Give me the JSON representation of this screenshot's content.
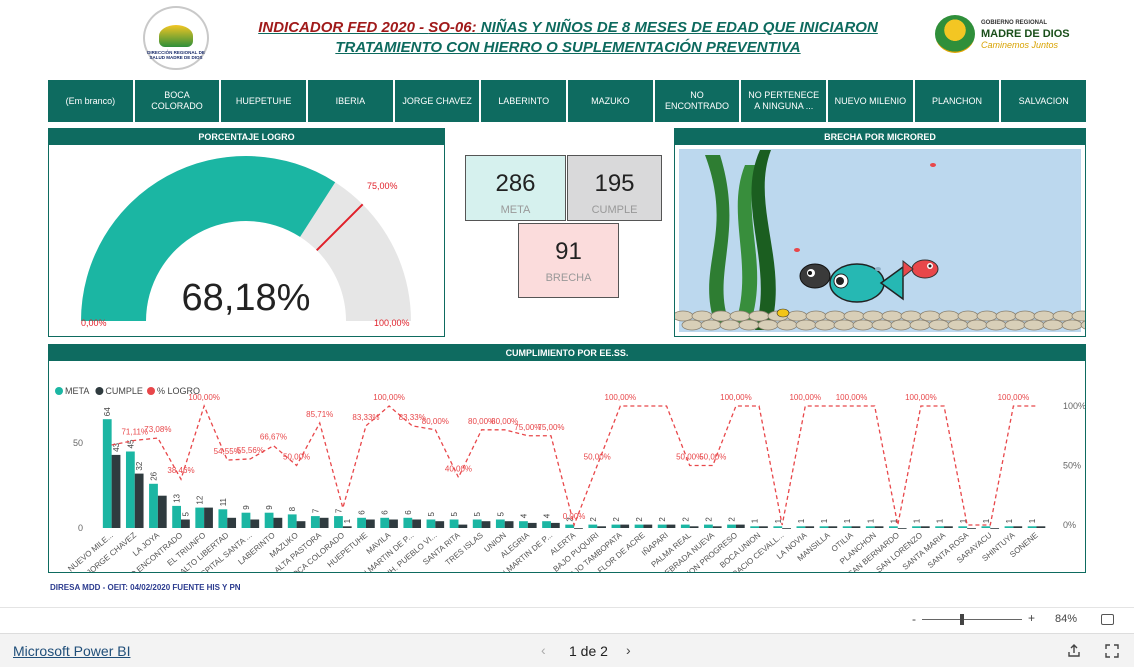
{
  "header": {
    "left_logo_text": "DIRECCIÓN REGIONAL DE SALUD MADRE DE DIOS",
    "title_part1": "INDICADOR FED 2020 - ",
    "title_code": "SO-06:",
    "title_part2": " NIÑAS Y NIÑOS DE 8 MESES DE EDAD QUE INICIARON",
    "title_line2": "TRATAMIENTO CON HIERRO O SUPLEMENTACIÓN PREVENTIVA",
    "right_logo": {
      "line1": "GOBIERNO REGIONAL",
      "line2": "MADRE DE DIOS",
      "line3": "Caminemos Juntos"
    }
  },
  "slicer": [
    "(Em branco)",
    "BOCA COLORADO",
    "HUEPETUHE",
    "IBERIA",
    "JORGE CHAVEZ",
    "LABERINTO",
    "MAZUKO",
    "NO ENCONTRADO",
    "NO PERTENECE A NINGUNA ...",
    "NUEVO MILENIO",
    "PLANCHON",
    "SALVACION"
  ],
  "gauge": {
    "title": "PORCENTAJE LOGRO",
    "value_label": "68,18%",
    "value": 68.18,
    "target": 75,
    "target_label": "75,00%",
    "min_label": "0,00%",
    "max_label": "100,00%",
    "fill_color": "#1bb6a3",
    "target_color": "#e0202a"
  },
  "kpis": {
    "meta": {
      "value": "286",
      "label": "META"
    },
    "cumple": {
      "value": "195",
      "label": "CUMPLE"
    },
    "brecha": {
      "value": "91",
      "label": "BRECHA"
    }
  },
  "aquarium": {
    "title": "BRECHA POR MICRORED"
  },
  "chart_title": "CUMPLIMIENTO POR EE.SS.",
  "chart_data": {
    "type": "bar",
    "legend": [
      "META",
      "CUMPLE",
      "% LOGRO"
    ],
    "colors": {
      "meta": "#1bb6a3",
      "cumple": "#2f3b3f",
      "logro": "#e8474a"
    },
    "categories": [
      "NUEVO MILE...",
      "JORGE CHAVEZ",
      "LA JOYA",
      "NO ENCONTRADO",
      "EL TRIUNFO",
      "ALTO LIBERTAD",
      "HOSPITAL SANTA ...",
      "LABERINTO",
      "MAZUKO",
      "ALTA PASTORA",
      "BOCA COLORADO",
      "HUEPETUHE",
      "MAVILA",
      "SAN MARTIN DE P...",
      "AA.HH. PUEBLO VI...",
      "SANTA RITA",
      "TRES ISLAS",
      "UNION",
      "ALEGRIA",
      "SAN MARTIN DE P...",
      "ALERTA",
      "BAJO PUQUIRI",
      "BAJO TAMBOPATA",
      "FLOR DE ACRE",
      "IÑAPARI",
      "PALMA REAL",
      "QUEBRADA NUEVA",
      "UNION PROGRESO",
      "BOCA UNION",
      "HORACIO CEVALL...",
      "LA NOVIA",
      "MANSILLA",
      "OTILIA",
      "PLANCHON",
      "SAN BERNARDO",
      "SAN LORENZO",
      "SANTA MARIA",
      "SANTA ROSA",
      "SARAYACU",
      "SHINTUYA",
      "SONENE"
    ],
    "meta": [
      64,
      45,
      26,
      13,
      12,
      11,
      9,
      9,
      8,
      7,
      7,
      6,
      6,
      6,
      5,
      5,
      5,
      5,
      4,
      4,
      2,
      2,
      2,
      2,
      2,
      2,
      2,
      2,
      1,
      1,
      1,
      1,
      1,
      1,
      1,
      1,
      1,
      1,
      1,
      1,
      1
    ],
    "cumple": [
      43,
      32,
      19,
      5,
      12,
      6,
      5,
      6,
      4,
      6,
      1,
      5,
      5,
      5,
      4,
      2,
      4,
      4,
      3,
      3,
      0,
      1,
      2,
      2,
      2,
      1,
      1,
      2,
      1,
      0,
      1,
      1,
      1,
      1,
      0,
      1,
      1,
      0,
      0,
      1,
      1
    ],
    "logro": [
      67.19,
      71.11,
      73.08,
      38.46,
      100.0,
      54.55,
      55.56,
      66.67,
      50.0,
      85.71,
      14.29,
      83.33,
      100.0,
      83.33,
      80.0,
      40.0,
      80.0,
      80.0,
      75.0,
      75.0,
      0.0,
      50.0,
      100.0,
      100.0,
      100.0,
      50.0,
      50.0,
      100.0,
      100.0,
      0.0,
      100.0,
      100.0,
      100.0,
      100.0,
      0.0,
      100.0,
      100.0,
      0.0,
      0.0,
      100.0,
      100.0
    ],
    "meta_labels": [
      "64",
      "45",
      "26",
      "13",
      "12",
      "11",
      "9",
      "9",
      "8",
      "7",
      "7",
      "6",
      "6",
      "6",
      "5",
      "5",
      "5",
      "5",
      "4",
      "4",
      "2",
      "2",
      "2",
      "2",
      "2",
      "2",
      "2",
      "2",
      "1",
      "1",
      "1",
      "1",
      "1",
      "1",
      "1",
      "1",
      "1",
      "1",
      "1",
      "1",
      "1"
    ],
    "cumple_labels": [
      "43",
      "32",
      "",
      "5",
      "",
      "",
      "",
      "",
      "",
      "",
      "1",
      "",
      "",
      "",
      "",
      "",
      "",
      "",
      "",
      "",
      "",
      "",
      "",
      "",
      "",
      "",
      "",
      "",
      "",
      "",
      "",
      "",
      "",
      "",
      "",
      "",
      "",
      "",
      "",
      "",
      ""
    ],
    "logro_labels": [
      "",
      "71,11%",
      "73,08%",
      "38,46%",
      "100,00%",
      "54,55%",
      "55,56%",
      "66,67%",
      "50,00%",
      "85,71%",
      "",
      "83,33%",
      "100,00%",
      "83,33%",
      "80,00%",
      "40,00%",
      "80,00%",
      "80,00%",
      "75,00%",
      "75,00%",
      "0,00%",
      "50,00%",
      "100,00%",
      "",
      "",
      "50,00%",
      "50,00%",
      "100,00%",
      "",
      "",
      "100,00%",
      "",
      "100,00%",
      "",
      "",
      "100,00%",
      "",
      "",
      "",
      "100,00%",
      ""
    ],
    "y_left_ticks": [
      "50",
      "0"
    ],
    "y_right_ticks": [
      "100%",
      "50%",
      "0%"
    ],
    "ylim_left": [
      0,
      70
    ],
    "ylim_right": [
      0,
      100
    ]
  },
  "footer_note": "DIRESA MDD - OEIT:  04/02/2020 FUENTE HIS Y PN",
  "zoom": {
    "minus": "-",
    "plus": "+",
    "level": "84%"
  },
  "bottom": {
    "brand": "Microsoft Power BI",
    "page": "1 de 2"
  }
}
